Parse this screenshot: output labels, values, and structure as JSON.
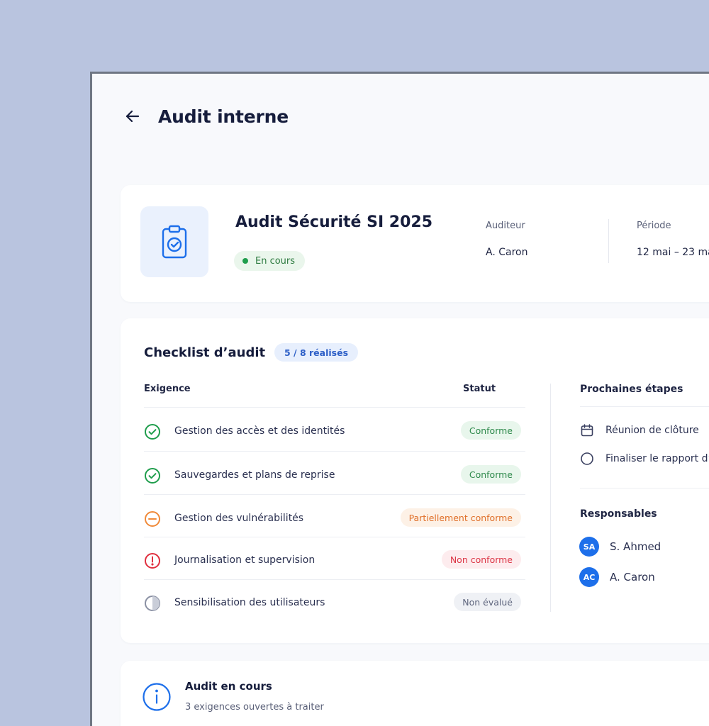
{
  "header": {
    "title": "Audit interne"
  },
  "audit": {
    "name": "Audit Sécurité SI 2025",
    "status": "En cours",
    "auditor_label": "Auditeur",
    "auditor_value": "A. Caron",
    "period_label": "Période",
    "period_value": "12 mai – 23 ma"
  },
  "checklist": {
    "title": "Checklist d’audit",
    "count": "5 / 8 réalisés",
    "col_requirement": "Exigence",
    "col_status": "Statut",
    "rows": [
      {
        "label": "Gestion des accès et des identités",
        "status": "Conforme",
        "icon": "check-circle-icon"
      },
      {
        "label": "Sauvegardes et plans de reprise",
        "status": "Conforme",
        "icon": "check-circle-icon"
      },
      {
        "label": "Gestion des vulnérabilités",
        "status": "Partiellement conforme",
        "icon": "minus-circle-icon"
      },
      {
        "label": "Journalisation et supervision",
        "status": "Non conforme",
        "icon": "alert-circle-icon"
      },
      {
        "label": "Sensibilisation des utilisateurs",
        "status": "Non évalué",
        "icon": "half-circle-icon"
      }
    ]
  },
  "next_steps": {
    "title": "Prochaines étapes",
    "items": [
      {
        "label": "Réunion de clôture",
        "icon": "calendar-icon"
      },
      {
        "label": "Finaliser le rapport d’",
        "icon": "circle-icon"
      }
    ]
  },
  "responsables": {
    "title": "Responsables",
    "people": [
      {
        "initials": "SA",
        "name": "S. Ahmed"
      },
      {
        "initials": "AC",
        "name": "A. Caron"
      }
    ]
  },
  "info": {
    "title": "Audit en cours",
    "subtitle": "3 exigences ouvertes à traiter"
  },
  "colors": {
    "accent": "#1d6fea",
    "success": "#1f9d4c",
    "warning": "#f08a3a",
    "danger": "#e0303f",
    "neutral": "#8a90a3"
  }
}
